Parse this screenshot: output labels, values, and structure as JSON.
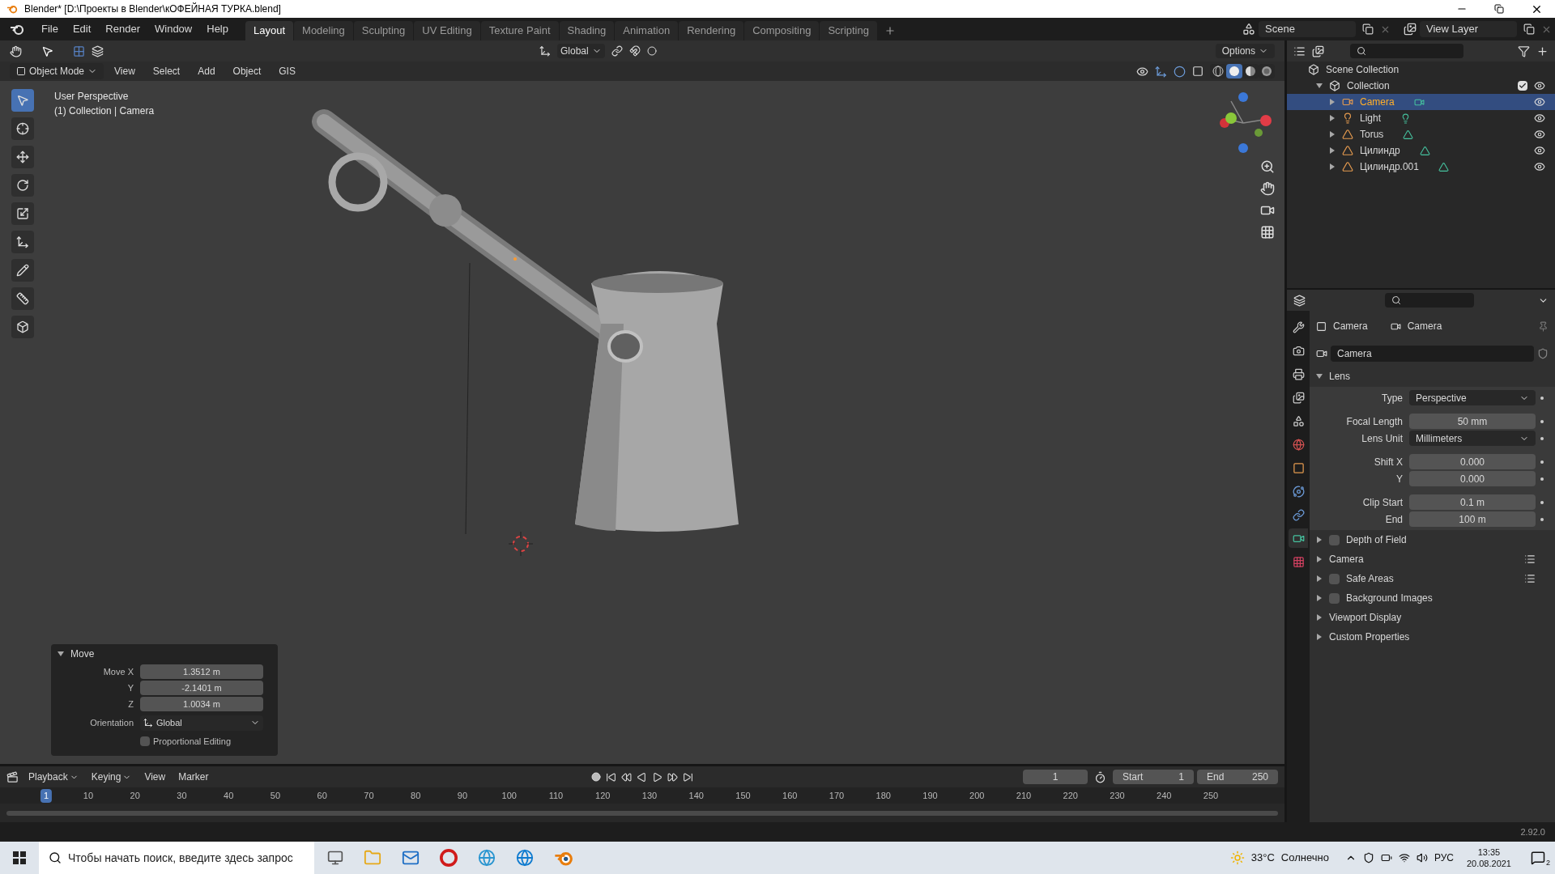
{
  "window": {
    "title": "Blender* [D:\\Проекты в Blender\\кОФЕЙНАЯ ТУРКА.blend]"
  },
  "menu": [
    "File",
    "Edit",
    "Render",
    "Window",
    "Help"
  ],
  "workspaces": [
    {
      "label": "Layout",
      "selected": true
    },
    {
      "label": "Modeling",
      "selected": false
    },
    {
      "label": "Sculpting",
      "selected": false
    },
    {
      "label": "UV Editing",
      "selected": false
    },
    {
      "label": "Texture Paint",
      "selected": false
    },
    {
      "label": "Shading",
      "selected": false
    },
    {
      "label": "Animation",
      "selected": false
    },
    {
      "label": "Rendering",
      "selected": false
    },
    {
      "label": "Compositing",
      "selected": false
    },
    {
      "label": "Scripting",
      "selected": false
    }
  ],
  "scene": "Scene",
  "view_layer": "View Layer",
  "tool_header": {
    "orientation": "Global",
    "options": "Options"
  },
  "viewport_header": {
    "mode": "Object Mode",
    "menus": [
      "View",
      "Select",
      "Add",
      "Object",
      "GIS"
    ]
  },
  "shading": [
    {
      "kind": "wireframe",
      "selected": false
    },
    {
      "kind": "solid",
      "selected": true
    },
    {
      "kind": "material",
      "selected": false
    },
    {
      "kind": "rendered",
      "selected": false
    }
  ],
  "viewport": {
    "overlay_lines": [
      "User Perspective",
      "(1) Collection | Camera"
    ]
  },
  "operator_panel": {
    "title": "Move",
    "expanded": true,
    "fields": [
      {
        "label": "Move X",
        "value": "1.3512 m"
      },
      {
        "label": "Y",
        "value": "-2.1401 m"
      },
      {
        "label": "Z",
        "value": "1.0034 m"
      }
    ],
    "orientation_label": "Orientation",
    "orientation": "Global",
    "proportional": {
      "label": "Proportional Editing",
      "checked": false
    }
  },
  "timeline": {
    "menus": [
      "Playback",
      "Keying",
      "View",
      "Marker"
    ],
    "current_frame": "1",
    "start_label": "Start",
    "start": "1",
    "end_label": "End",
    "end": "250",
    "ruler": [
      {
        "label": "1",
        "selected": true
      },
      {
        "label": "10",
        "selected": false
      },
      {
        "label": "20",
        "selected": false
      },
      {
        "label": "30",
        "selected": false
      },
      {
        "label": "40",
        "selected": false
      },
      {
        "label": "50",
        "selected": false
      },
      {
        "label": "60",
        "selected": false
      },
      {
        "label": "70",
        "selected": false
      },
      {
        "label": "80",
        "selected": false
      },
      {
        "label": "90",
        "selected": false
      },
      {
        "label": "100",
        "selected": false
      },
      {
        "label": "110",
        "selected": false
      },
      {
        "label": "120",
        "selected": false
      },
      {
        "label": "130",
        "selected": false
      },
      {
        "label": "140",
        "selected": false
      },
      {
        "label": "150",
        "selected": false
      },
      {
        "label": "160",
        "selected": false
      },
      {
        "label": "170",
        "selected": false
      },
      {
        "label": "180",
        "selected": false
      },
      {
        "label": "190",
        "selected": false
      },
      {
        "label": "200",
        "selected": false
      },
      {
        "label": "210",
        "selected": false
      },
      {
        "label": "220",
        "selected": false
      },
      {
        "label": "230",
        "selected": false
      },
      {
        "label": "240",
        "selected": false
      },
      {
        "label": "250",
        "selected": false
      }
    ]
  },
  "outliner": {
    "root": "Scene Collection",
    "collection": {
      "name": "Collection",
      "expanded": true,
      "checked": true,
      "children": [
        {
          "name": "Camera",
          "kind": "camera",
          "selected": true,
          "expanded": false
        },
        {
          "name": "Light",
          "kind": "light",
          "selected": false,
          "expanded": false
        },
        {
          "name": "Torus",
          "kind": "mesh",
          "selected": false,
          "expanded": false
        },
        {
          "name": "Цилиндр",
          "kind": "mesh",
          "selected": false,
          "expanded": false
        },
        {
          "name": "Цилиндр.001",
          "kind": "mesh",
          "selected": false,
          "expanded": false
        }
      ]
    }
  },
  "properties": {
    "tabs": [
      {
        "kind": "tool",
        "selected": false
      },
      {
        "kind": "render",
        "selected": false
      },
      {
        "kind": "output",
        "selected": false
      },
      {
        "kind": "view_layer",
        "selected": false
      },
      {
        "kind": "scene",
        "selected": false
      },
      {
        "kind": "world",
        "selected": false
      },
      {
        "kind": "object",
        "selected": false
      },
      {
        "kind": "physics",
        "selected": false
      },
      {
        "kind": "constraints",
        "selected": false
      },
      {
        "kind": "data",
        "selected": true
      },
      {
        "kind": "texture",
        "selected": false
      }
    ],
    "breadcrumb": [
      "Camera",
      "Camera"
    ],
    "datablock": "Camera",
    "lens": {
      "title": "Lens",
      "expanded": true,
      "fields": [
        {
          "label": "Type",
          "value": "Perspective",
          "kind": "dropdown"
        },
        {
          "label": "Focal Length",
          "value": "50 mm",
          "kind": "number"
        },
        {
          "label": "Lens Unit",
          "value": "Millimeters",
          "kind": "dropdown"
        },
        {
          "label": "Shift X",
          "value": "0.000",
          "kind": "number"
        },
        {
          "label": "Y",
          "value": "0.000",
          "kind": "number"
        },
        {
          "label": "Clip Start",
          "value": "0.1 m",
          "kind": "number"
        },
        {
          "label": "End",
          "value": "100 m",
          "kind": "number"
        }
      ]
    },
    "panels": [
      {
        "title": "Depth of Field",
        "kind": "checkbox",
        "checked": false,
        "presets": false
      },
      {
        "title": "Camera",
        "kind": "plain",
        "presets": true
      },
      {
        "title": "Safe Areas",
        "kind": "checkbox",
        "checked": false,
        "presets": true
      },
      {
        "title": "Background Images",
        "kind": "checkbox",
        "checked": false,
        "presets": false
      },
      {
        "title": "Viewport Display",
        "kind": "plain",
        "presets": false
      },
      {
        "title": "Custom Properties",
        "kind": "plain",
        "presets": false
      }
    ]
  },
  "status_bar": {
    "version": "2.92.0"
  },
  "taskbar": {
    "search_placeholder": "Чтобы начать поиск, введите здесь запрос",
    "temperature": "33°C",
    "weather": "Солнечно",
    "language": "РУС",
    "time": "13:35",
    "date": "20.08.2021",
    "notifications": "2"
  }
}
